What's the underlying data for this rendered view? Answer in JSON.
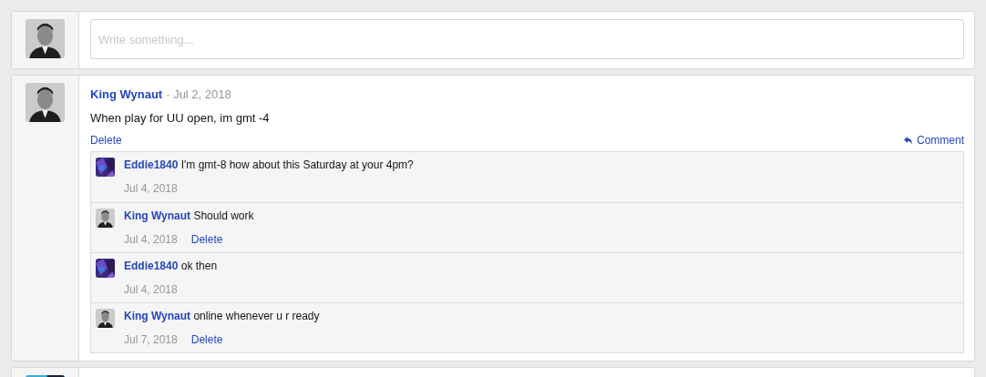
{
  "composer": {
    "placeholder": "Write something..."
  },
  "post": {
    "author": "King Wynaut",
    "separator": "·",
    "date": "Jul 2, 2018",
    "text": "When play for UU open, im gmt -4",
    "delete": "Delete",
    "comment": "Comment",
    "replies": [
      {
        "author": "Eddie1840",
        "text": "I'm gmt-8 how about this Saturday at your 4pm?",
        "date": "Jul 4, 2018"
      },
      {
        "author": "King Wynaut",
        "text": "Should work",
        "date": "Jul 4, 2018",
        "delete": "Delete"
      },
      {
        "author": "Eddie1840",
        "text": "ok then",
        "date": "Jul 4, 2018"
      },
      {
        "author": "King Wynaut",
        "text": "online whenever u r ready",
        "date": "Jul 7, 2018",
        "delete": "Delete"
      }
    ]
  }
}
